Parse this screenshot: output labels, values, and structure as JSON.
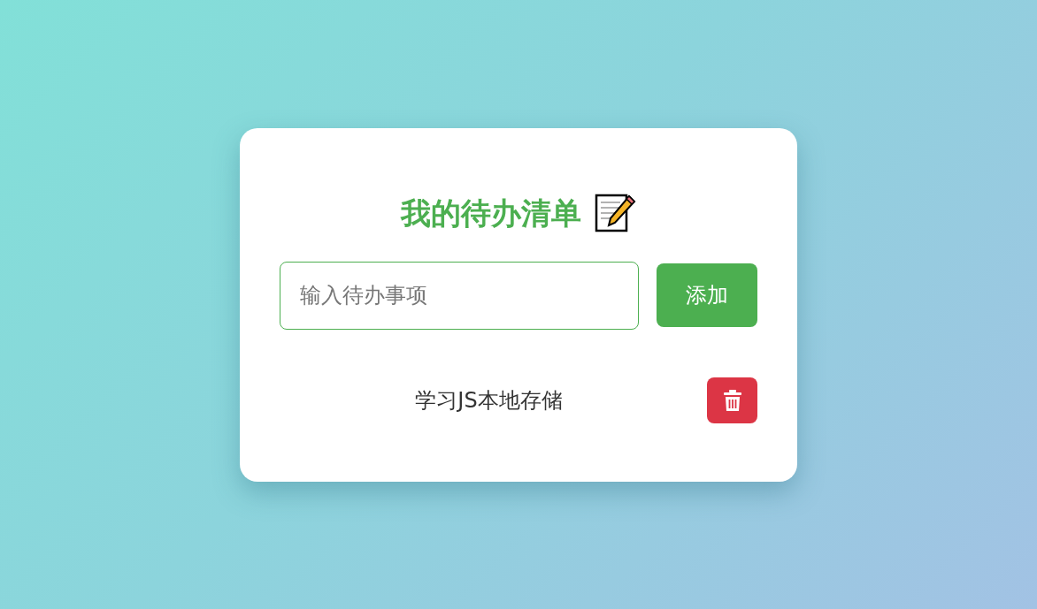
{
  "title": "我的待办清单",
  "input": {
    "placeholder": "输入待办事项"
  },
  "add_button": {
    "label": "添加"
  },
  "todos": [
    {
      "text": "学习JS本地存储"
    }
  ]
}
